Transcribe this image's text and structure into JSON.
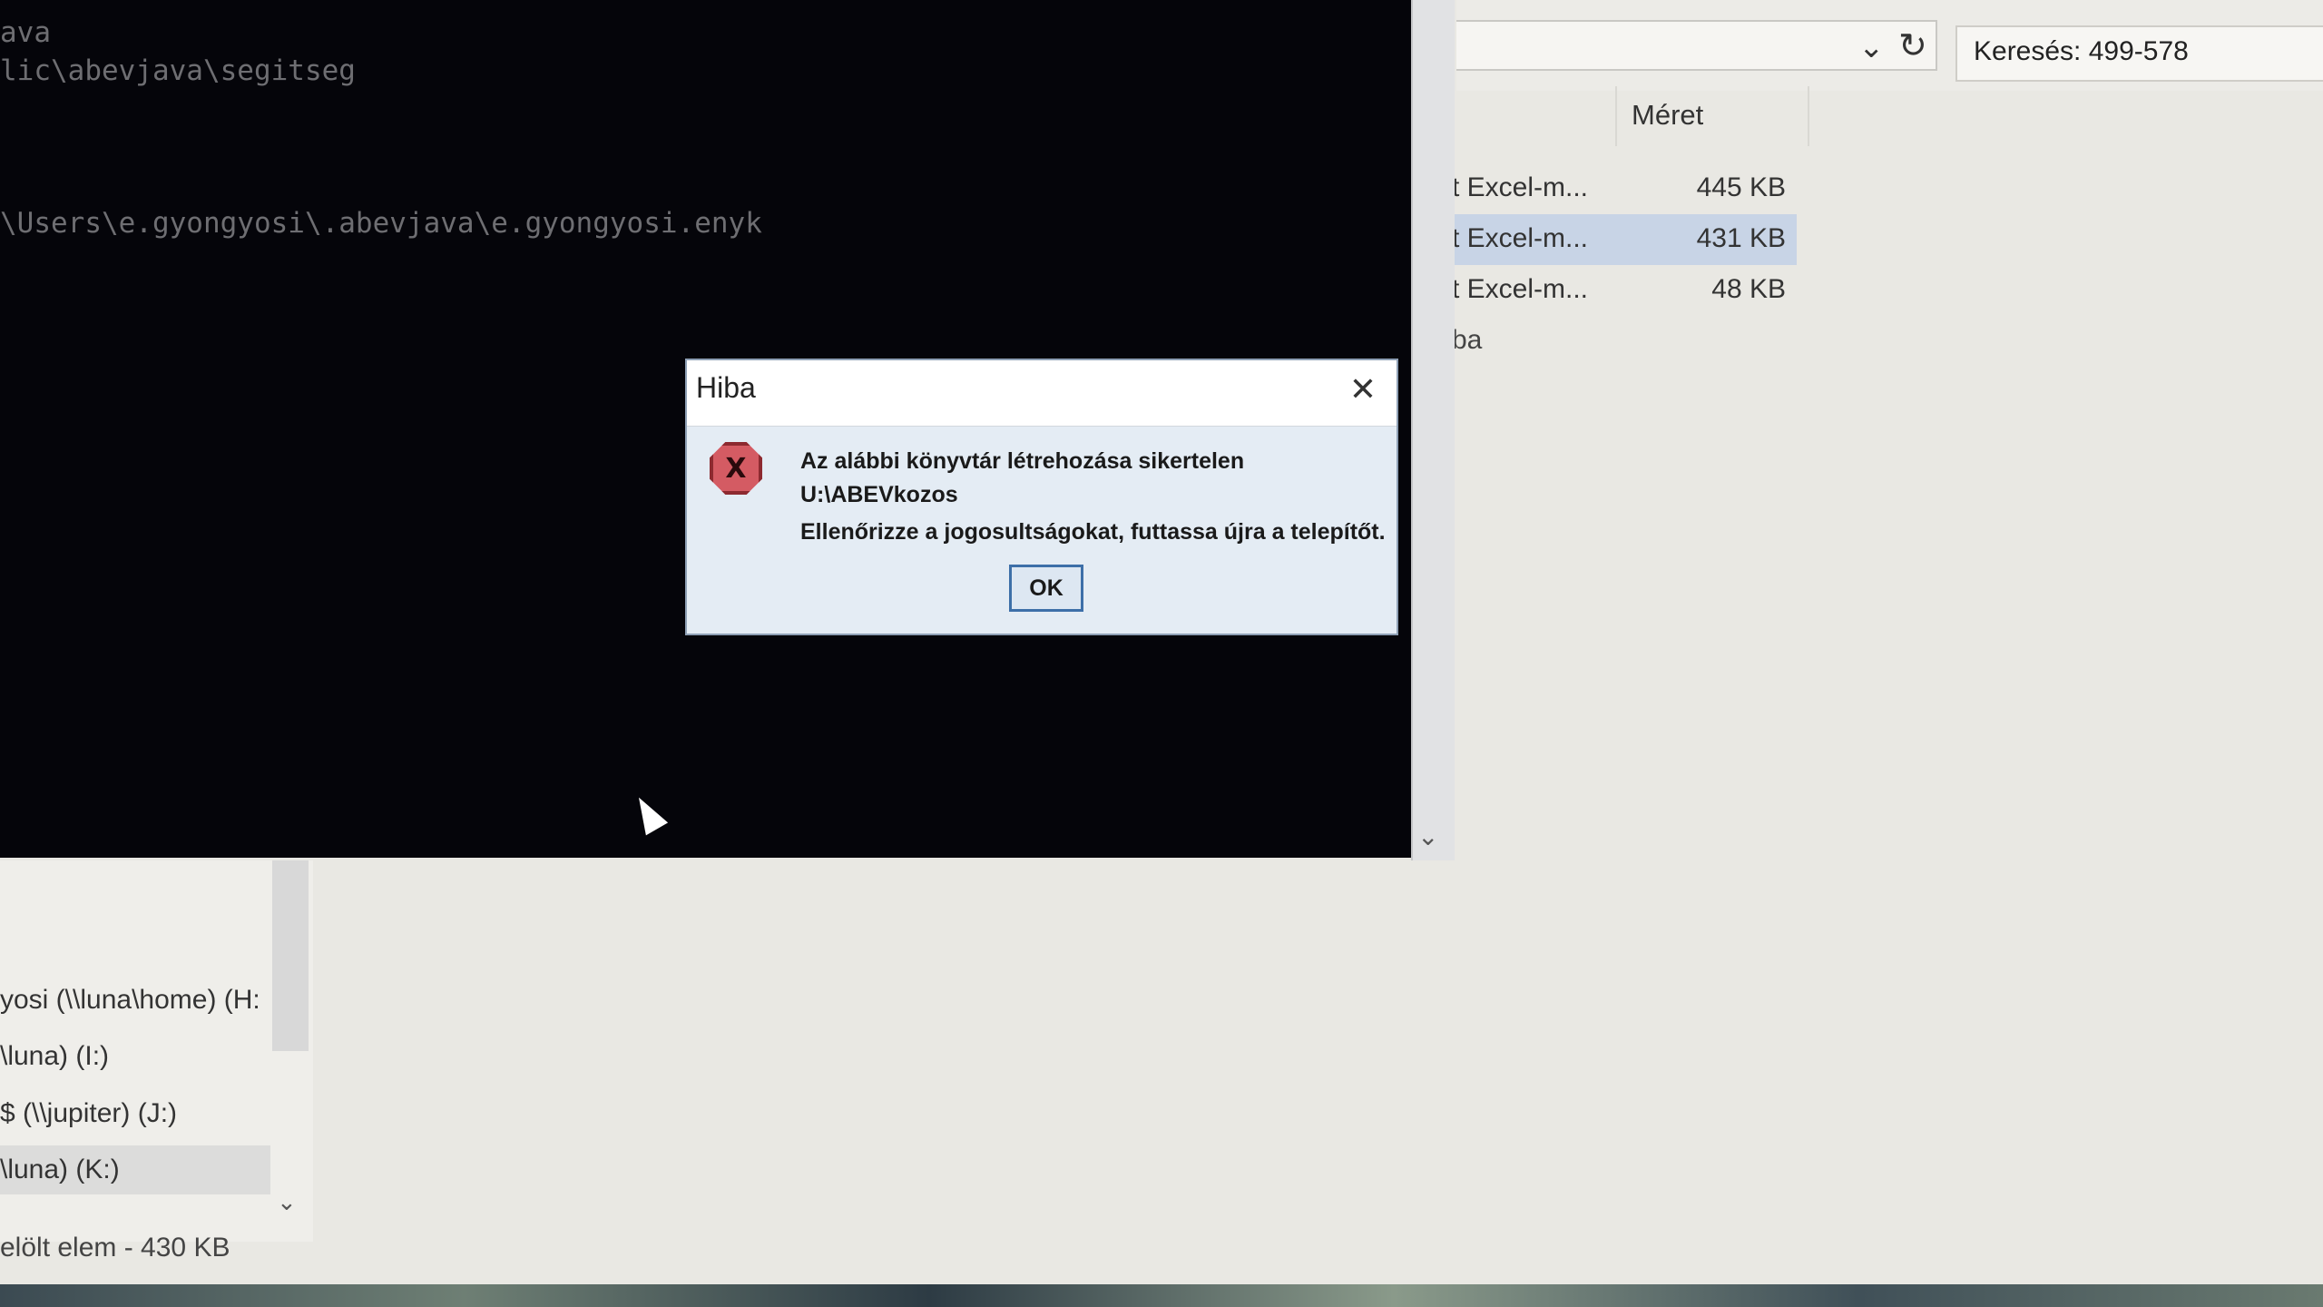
{
  "explorer": {
    "search_placeholder": "Keresés: 499-578",
    "column_size": "Méret",
    "files": [
      {
        "name": "t Excel-m...",
        "size": "445 KB",
        "selected": false
      },
      {
        "name": "t Excel-m...",
        "size": "431 KB",
        "selected": true
      },
      {
        "name": "t Excel-m...",
        "size": "48 KB",
        "selected": false
      }
    ],
    "partial_label": "ba",
    "nav_items": [
      {
        "label": "yosi (\\\\luna\\home) (H:",
        "selected": false
      },
      {
        "label": "\\luna) (I:)",
        "selected": false
      },
      {
        "label": "$ (\\\\jupiter) (J:)",
        "selected": false
      },
      {
        "label": "\\luna) (K:)",
        "selected": true
      }
    ],
    "status": "elölt elem - 430 KB"
  },
  "console": {
    "lines": [
      "ava",
      "lic\\abevjava\\segitseg",
      "\\Users\\e.gyongyosi\\.abevjava\\e.gyongyosi.enyk"
    ]
  },
  "dialog": {
    "title": "Hiba",
    "line1": "Az alábbi könyvtár létrehozása sikertelen",
    "line2": "U:\\ABEVkozos",
    "line3": "Ellenőrizze a jogosultságokat, futtassa újra a telepítőt.",
    "ok_label": "OK",
    "icon": "error-icon",
    "icon_glyph": "X"
  }
}
